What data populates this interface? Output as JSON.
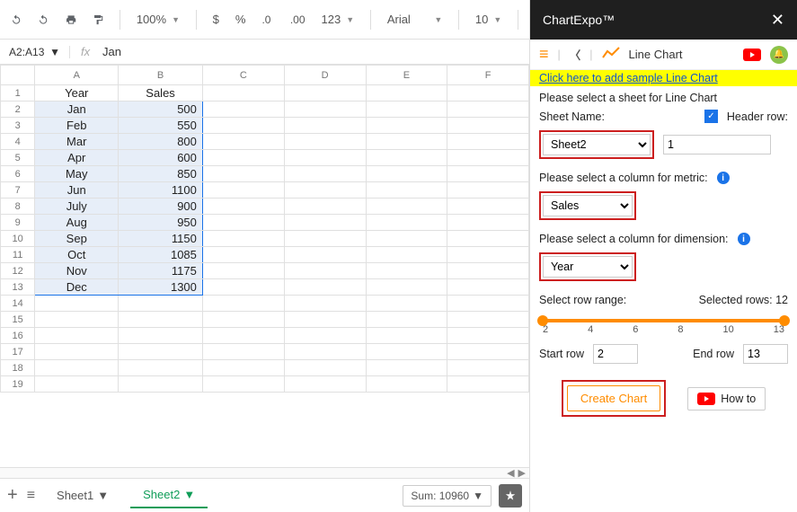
{
  "toolbar": {
    "zoom": "100%",
    "font": "Arial",
    "font_size": "10"
  },
  "formula": {
    "name_box": "A2:A13",
    "fx_label": "fx",
    "value": "Jan"
  },
  "columns": [
    "A",
    "B",
    "C",
    "D",
    "E",
    "F"
  ],
  "headers": {
    "A": "Year",
    "B": "Sales"
  },
  "data": [
    {
      "year": "Jan",
      "sales": 500
    },
    {
      "year": "Feb",
      "sales": 550
    },
    {
      "year": "Mar",
      "sales": 800
    },
    {
      "year": "Apr",
      "sales": 600
    },
    {
      "year": "May",
      "sales": 850
    },
    {
      "year": "Jun",
      "sales": 1100
    },
    {
      "year": "July",
      "sales": 900
    },
    {
      "year": "Aug",
      "sales": 950
    },
    {
      "year": "Sep",
      "sales": 1150
    },
    {
      "year": "Oct",
      "sales": 1085
    },
    {
      "year": "Nov",
      "sales": 1175
    },
    {
      "year": "Dec",
      "sales": 1300
    }
  ],
  "tabs": {
    "sheet1": "Sheet1",
    "sheet2": "Sheet2"
  },
  "status": {
    "sum_label": "Sum: 10960"
  },
  "panel": {
    "title": "ChartExpo™",
    "chart_type": "Line Chart",
    "sample_link": "Click here to add sample Line Chart",
    "select_sheet_label": "Please select a sheet for Line Chart",
    "sheet_name_label": "Sheet Name:",
    "header_row_label": "Header row:",
    "sheet_value": "Sheet2",
    "header_row_value": "1",
    "metric_label": "Please select a column for metric:",
    "metric_value": "Sales",
    "dimension_label": "Please select a column for dimension:",
    "dimension_value": "Year",
    "range_label": "Select row range:",
    "selected_rows": "Selected rows: 12",
    "slider_ticks": [
      "2",
      "4",
      "6",
      "8",
      "10",
      "13"
    ],
    "start_row_label": "Start row",
    "start_row_value": "2",
    "end_row_label": "End row",
    "end_row_value": "13",
    "create_btn": "Create Chart",
    "howto_btn": "How to"
  },
  "chart_data": {
    "type": "line",
    "title": "Line Chart",
    "xlabel": "Year",
    "ylabel": "Sales",
    "categories": [
      "Jan",
      "Feb",
      "Mar",
      "Apr",
      "May",
      "Jun",
      "July",
      "Aug",
      "Sep",
      "Oct",
      "Nov",
      "Dec"
    ],
    "values": [
      500,
      550,
      800,
      600,
      850,
      1100,
      900,
      950,
      1150,
      1085,
      1175,
      1300
    ]
  }
}
